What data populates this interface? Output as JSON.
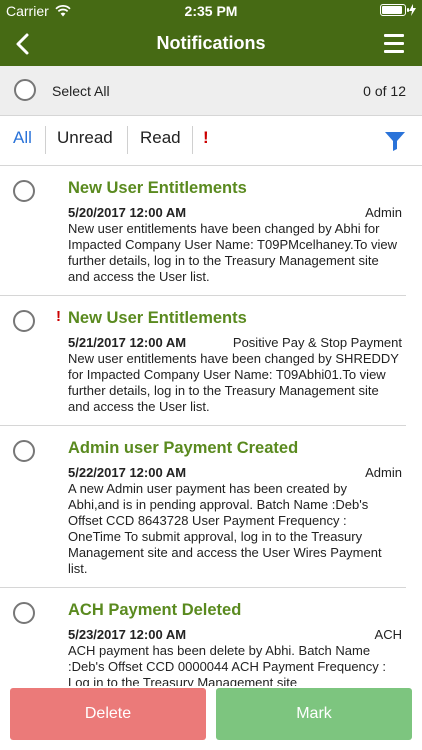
{
  "status": {
    "carrier": "Carrier",
    "time": "2:35 PM",
    "battery_level": 0.9
  },
  "nav": {
    "title": "Notifications"
  },
  "select_bar": {
    "label": "Select All",
    "count": "0 of 12"
  },
  "filters": [
    {
      "label": "All",
      "active": true
    },
    {
      "label": "Unread",
      "active": false
    },
    {
      "label": "Read",
      "active": false
    }
  ],
  "urgent_marker": "!",
  "colors": {
    "header": "#466a14",
    "title": "#5a8a1f",
    "accent": "#2a73d9",
    "urgent": "#cc0000",
    "delete": "#eb7a79",
    "mark": "#7dc57f"
  },
  "notifications": [
    {
      "urgent": false,
      "title": "New User Entitlements",
      "date": "5/20/2017 12:00 AM",
      "source": "Admin",
      "description": "New user entitlements have been changed by Abhi for Impacted Company User Name: T09PMcelhaney.To view further details, log in to the Treasury Management site and access the User list."
    },
    {
      "urgent": true,
      "title": "New User Entitlements",
      "date": "5/21/2017 12:00 AM",
      "source": "Positive Pay & Stop Payment",
      "description": "New user entitlements have been changed by SHREDDY for Impacted Company User Name: T09Abhi01.To view further details, log in to the Treasury Management site and access the User list."
    },
    {
      "urgent": false,
      "title": "Admin user Payment Created",
      "date": "5/22/2017 12:00 AM",
      "source": "Admin",
      "description": "A new Admin user payment has been created by Abhi,and is in pending approval. Batch Name :Deb's Offset CCD 8643728 User Payment Frequency : OneTime To submit approval, log in to the Treasury Management site and access the User Wires Payment list."
    },
    {
      "urgent": false,
      "title": "ACH Payment Deleted",
      "date": "5/23/2017 12:00 AM",
      "source": "ACH",
      "description": "ACH payment has been delete by Abhi. Batch Name :Deb's Offset CCD 0000044 ACH Payment Frequency : Log in to the Treasury Management site"
    }
  ],
  "actions": {
    "delete_label": "Delete",
    "mark_label": "Mark"
  }
}
